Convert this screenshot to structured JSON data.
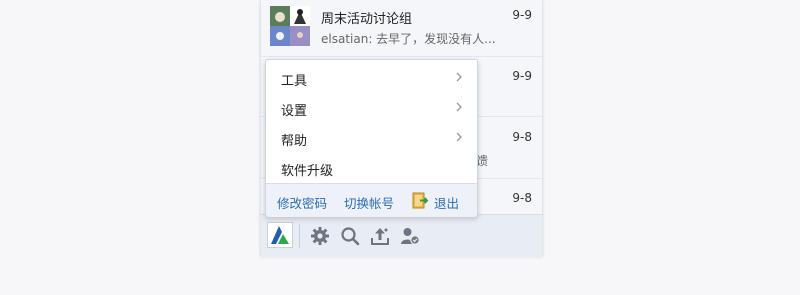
{
  "chats": [
    {
      "name": "周末活动讨论组",
      "preview": "elsatian: 去早了，发现没有人...",
      "time": "9-9",
      "avatar_icon": "group-photo-avatar"
    },
    {
      "time": "9-9"
    },
    {
      "preview_partial": "馈",
      "time": "9-8"
    },
    {
      "time": "9-8"
    }
  ],
  "menu": {
    "items": [
      {
        "label": "工具",
        "has_submenu": true
      },
      {
        "label": "设置",
        "has_submenu": true
      },
      {
        "label": "帮助",
        "has_submenu": true
      },
      {
        "label": "软件升级",
        "has_submenu": false
      }
    ],
    "footer": {
      "change_password": "修改密码",
      "switch_account": "切换帐号",
      "logout": "退出"
    }
  },
  "bottom_bar": {
    "icons": [
      "app-logo-icon",
      "settings-gear-icon",
      "search-icon",
      "upload-icon",
      "contacts-icon"
    ]
  },
  "colors": {
    "link": "#2a6cb0",
    "logo_blue": "#1f5fb0",
    "logo_green": "#2fa84a"
  }
}
